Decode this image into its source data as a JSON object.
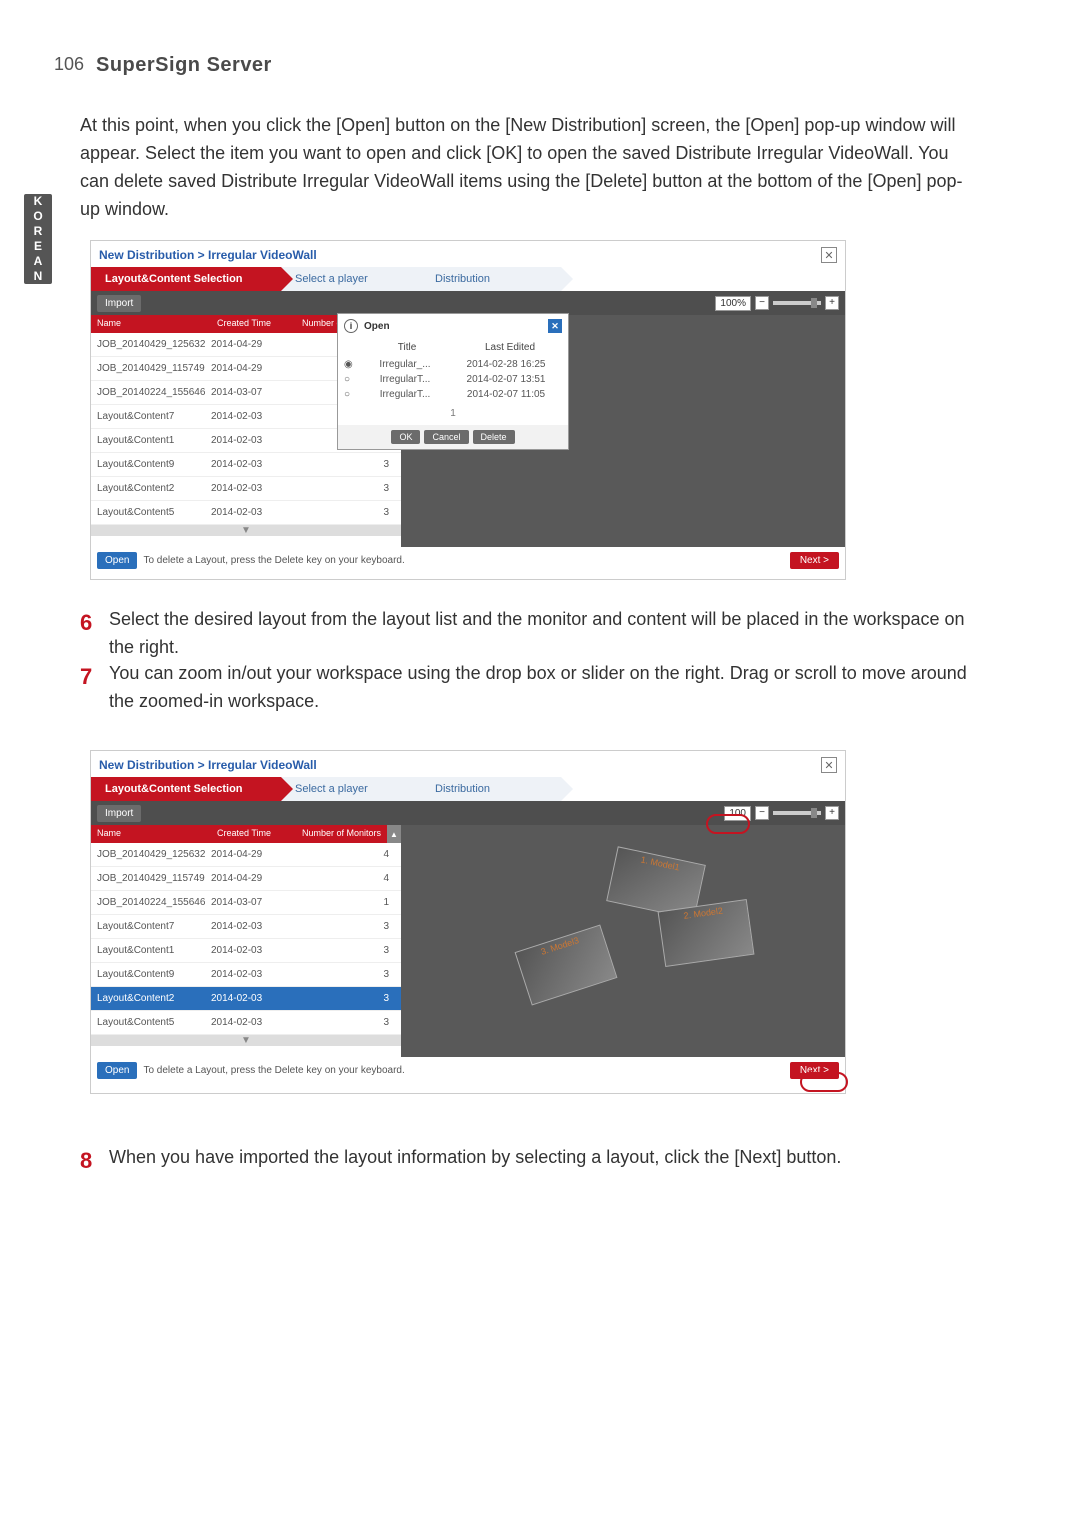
{
  "page": {
    "number": "106",
    "title": "SuperSign Server"
  },
  "sideTab": {
    "label": "KOREAN"
  },
  "paragraph": "At this point, when you click the [Open] button on the [New Distribution] screen, the [Open] pop-up window will appear. Select the item you want to open and click [OK] to open the saved Distribute Irregular VideoWall. You can delete saved Distribute Irregular VideoWall items using the [Delete] button at the bottom of the [Open] pop-up window.",
  "breadcrumb": "New Distribution > Irregular VideoWall",
  "steps": {
    "s1": "Layout&Content Selection",
    "s2": "Select a player",
    "s3": "Distribution"
  },
  "toolbar": {
    "import": "Import",
    "zoomPct1": "100%",
    "zoomPct2": "100"
  },
  "zoomButtons": {
    "minus": "−",
    "plus": "+"
  },
  "columns": {
    "name": "Name",
    "created": "Created Time",
    "monitors": "Number of Monitors"
  },
  "rows": [
    {
      "name": "JOB_20140429_125632",
      "created": "2014-04-29",
      "monitors": "4"
    },
    {
      "name": "JOB_20140429_115749",
      "created": "2014-04-29",
      "monitors": "4"
    },
    {
      "name": "JOB_20140224_155646",
      "created": "2014-03-07",
      "monitors": "1"
    },
    {
      "name": "Layout&Content7",
      "created": "2014-02-03",
      "monitors": "3"
    },
    {
      "name": "Layout&Content1",
      "created": "2014-02-03",
      "monitors": "3"
    },
    {
      "name": "Layout&Content9",
      "created": "2014-02-03",
      "monitors": "3"
    },
    {
      "name": "Layout&Content2",
      "created": "2014-02-03",
      "monitors": "3"
    },
    {
      "name": "Layout&Content5",
      "created": "2014-02-03",
      "monitors": "3"
    }
  ],
  "popup": {
    "title": "Open",
    "cols": {
      "title": "Title",
      "edited": "Last Edited"
    },
    "rows": [
      {
        "title": "Irregular_...",
        "edited": "2014-02-28 16:25"
      },
      {
        "title": "IrregularT...",
        "edited": "2014-02-07 13:51"
      },
      {
        "title": "IrregularT...",
        "edited": "2014-02-07 11:05"
      }
    ],
    "page": "1",
    "buttons": {
      "ok": "OK",
      "cancel": "Cancel",
      "del": "Delete"
    }
  },
  "footer": {
    "open": "Open",
    "hint": "To delete a Layout, press the Delete key on your keyboard.",
    "next": "Next >"
  },
  "list": {
    "n6": "6",
    "t6": "Select the desired layout from the layout list and the monitor and content will be placed in the workspace on the right.",
    "n7": "7",
    "t7": "You can zoom in/out your workspace using the drop box or slider on the right. Drag or scroll to move around the zoomed-in workspace.",
    "n8": "8",
    "t8": "When you have imported the layout information by selecting a layout, click the [Next] button."
  },
  "monitors": {
    "m1": "1. Model1",
    "m2": "2. Model2",
    "m3": "3. Model3"
  },
  "scrollArrows": {
    "up": "▲",
    "down": "▼"
  },
  "closeX": "✕",
  "infoI": "i",
  "radioDot": "◉",
  "radioEmpty": "○"
}
